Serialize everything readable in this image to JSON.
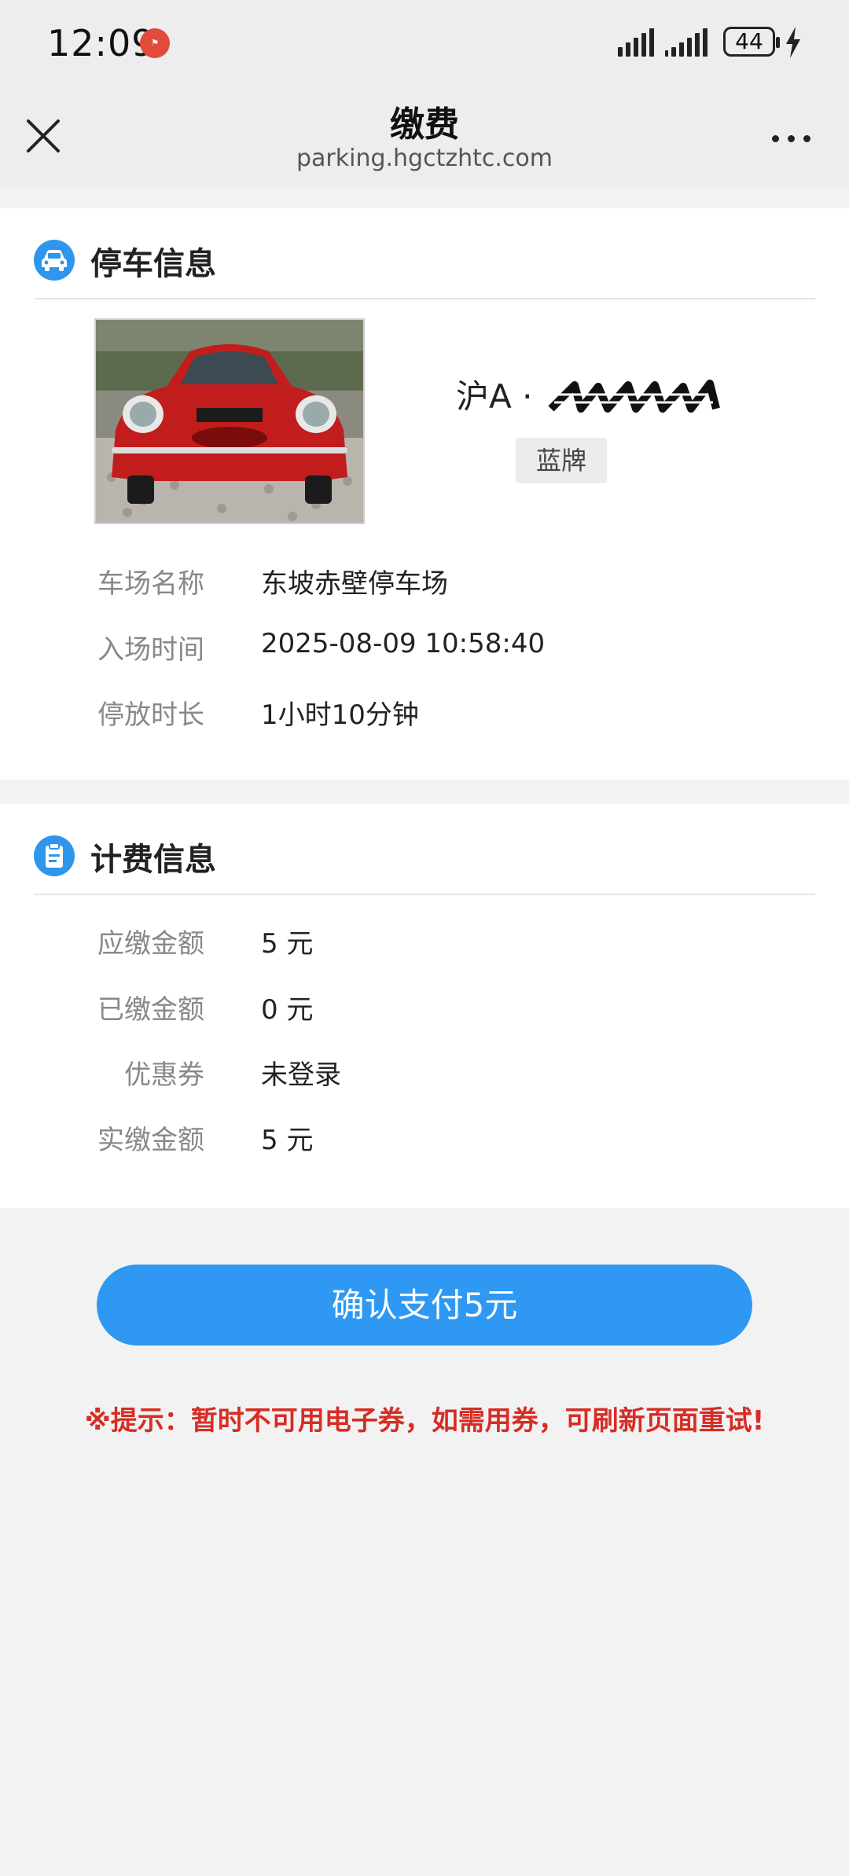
{
  "status_bar": {
    "time": "12:09",
    "battery": "44"
  },
  "nav": {
    "title": "缴费",
    "url": "parking.hgctzhtc.com"
  },
  "parking_info": {
    "title": "停车信息",
    "plate": "沪A · ",
    "plate_type": "蓝牌",
    "rows": [
      {
        "label": "车场名称",
        "value": "东坡赤壁停车场"
      },
      {
        "label": "入场时间",
        "value": "2025-08-09 10:58:40"
      },
      {
        "label": "停放时长",
        "value": "1小时10分钟"
      }
    ]
  },
  "fee_info": {
    "title": "计费信息",
    "rows": [
      {
        "label": "应缴金额",
        "value": "5 元"
      },
      {
        "label": "已缴金额",
        "value": "0 元"
      },
      {
        "label": "优惠券",
        "value": "未登录"
      },
      {
        "label": "实缴金额",
        "value": "5 元"
      }
    ]
  },
  "pay_button": "确认支付5元",
  "tip": "※提示：暂时不可用电子券，如需用券，可刷新页面重试!",
  "colors": {
    "accent": "#2e98f2",
    "tip": "#d62d24",
    "background": "#f2f2f2"
  },
  "icons": {
    "close": "close-icon",
    "more": "more-icon",
    "parking_header": "car-icon",
    "fee_header": "clipboard-icon"
  }
}
